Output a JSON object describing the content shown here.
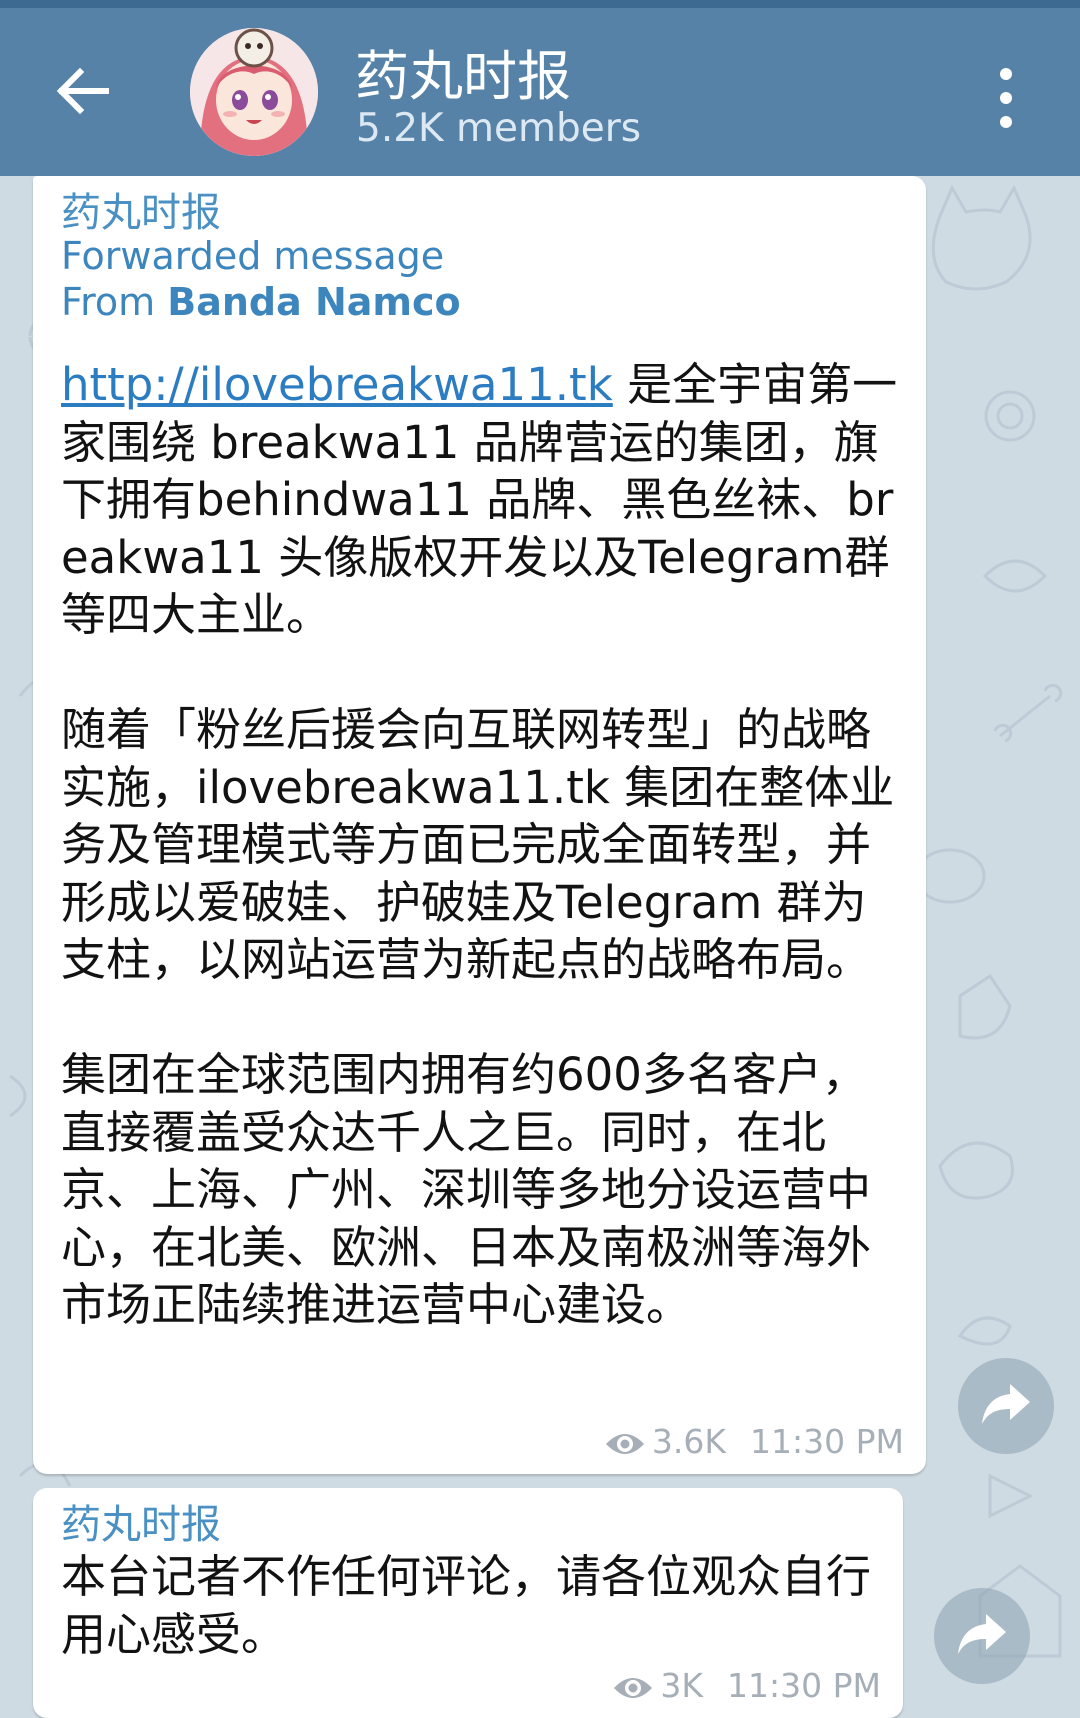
{
  "header": {
    "title": "药丸时报",
    "subtitle": "5.2K members"
  },
  "icons": {
    "back": "arrow-left-icon",
    "menu": "more-vertical-icon",
    "views": "eye-icon",
    "share": "share-icon"
  },
  "colors": {
    "header_bg": "#5682a8",
    "link": "#2c7cc2",
    "sender": "#4a90c2",
    "chat_bg": "#cfdbe3"
  },
  "messages": [
    {
      "sender": "药丸时报",
      "forward_label": "Forwarded message",
      "forward_from_prefix": "From ",
      "forward_from_name": "Banda Namco",
      "link": "http://ilovebreakwa11.tk",
      "text_after_link": " 是全宇宙第一家围绕 breakwa11 品牌营运的集团，旗下拥有behindwa11 品牌、黑色丝袜、breakwa11 头像版权开发以及Telegram群 等四大主业。\n\n随着「粉丝后援会向互联网转型」的战略实施，ilovebreakwa11.tk 集团在整体业务及管理模式等方面已完成全面转型，并形成以爱破娃、护破娃及Telegram 群为支柱，以网站运营为新起点的战略布局。\n\n集团在全球范围内拥有约600多名客户，直接覆盖受众达千人之巨。同时，在北京、上海、广州、深圳等多地分设运营中心，在北美、欧洲、日本及南极洲等海外市场正陆续推进运营中心建设。",
      "views": "3.6K",
      "time": "11:30 PM"
    },
    {
      "sender": "药丸时报",
      "text": "本台记者不作任何评论，请各位观众自行用心感受。",
      "views": "3K",
      "time": "11:30 PM"
    }
  ]
}
